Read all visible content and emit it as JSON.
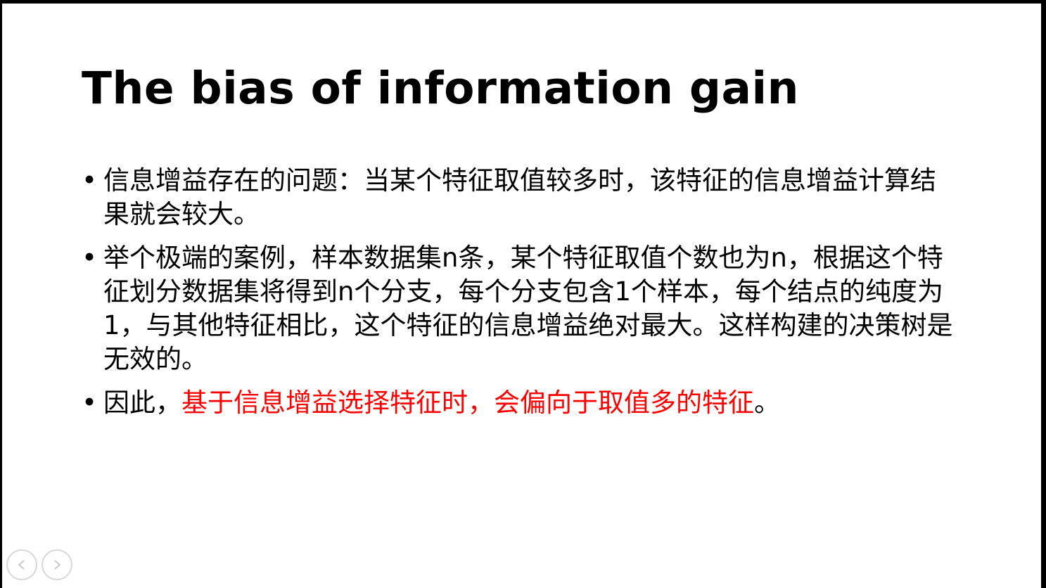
{
  "slide": {
    "title": "The bias of information gain",
    "bullets": [
      {
        "bullet": "•",
        "text": "信息增益存在的问题：当某个特征取值较多时，该特征的信息增益计算结果就会较大。"
      },
      {
        "bullet": "•",
        "text": "举个极端的案例，样本数据集n条，某个特征取值个数也为n，根据这个特征划分数据集将得到n个分支，每个分支包含1个样本，每个结点的纯度为1，与其他特征相比，这个特征的信息增益绝对最大。这样构建的决策树是无效的。"
      },
      {
        "bullet": "•",
        "prefix": "因此，",
        "highlight": "基于信息增益选择特征时，会偏向于取值多的特征",
        "suffix": "。"
      }
    ],
    "highlight_color": "#ff0000"
  },
  "nav": {
    "prev_icon": "chevron-left-icon",
    "next_icon": "chevron-right-icon"
  }
}
